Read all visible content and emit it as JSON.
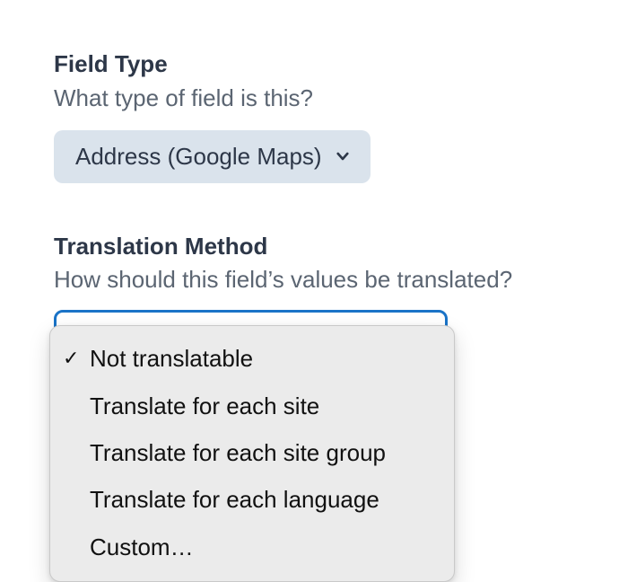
{
  "fieldType": {
    "label": "Field Type",
    "description": "What type of field is this?",
    "selectedValue": "Address (Google Maps)"
  },
  "translationMethod": {
    "label": "Translation Method",
    "description": "How should this field’s values be translated?",
    "options": [
      {
        "label": "Not translatable",
        "selected": true
      },
      {
        "label": "Translate for each site",
        "selected": false
      },
      {
        "label": "Translate for each site group",
        "selected": false
      },
      {
        "label": "Translate for each language",
        "selected": false
      },
      {
        "label": "Custom…",
        "selected": false
      }
    ]
  },
  "checkmark": "✓"
}
